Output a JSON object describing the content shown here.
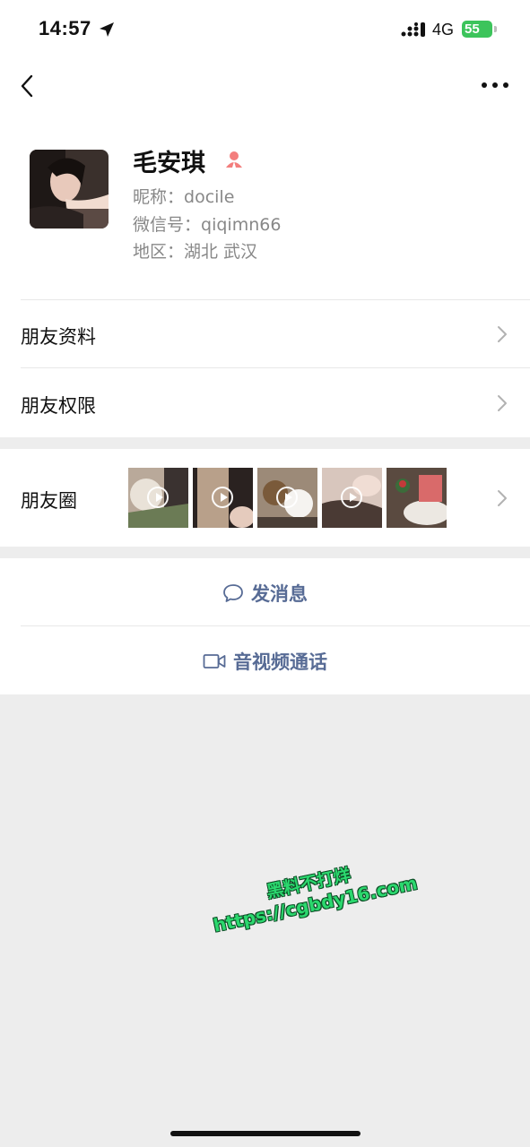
{
  "status_bar": {
    "time": "14:57",
    "network": "4G",
    "battery": "55"
  },
  "nav": {
    "back_icon": "chevron-left-icon",
    "more_icon": "more-dots-icon"
  },
  "profile": {
    "name": "毛安琪",
    "nickname_label": "昵称：",
    "nickname": "docile",
    "wechat_id_label": "微信号：",
    "wechat_id": "qiqimn66",
    "region_label": "地区：",
    "region": "湖北 武汉"
  },
  "rows": {
    "friend_info": "朋友资料",
    "friend_permissions": "朋友权限",
    "moments": "朋友圈"
  },
  "actions": {
    "send_message": "发消息",
    "voice_video_call": "音视频通话"
  },
  "watermark": {
    "line1": "黑料不打烊",
    "line2": "https://cgbdy16.com"
  },
  "colors": {
    "link_blue": "#576b95",
    "battery_green": "#3cc45b",
    "background": "#ededed",
    "gender_female": "#f37e7d"
  }
}
